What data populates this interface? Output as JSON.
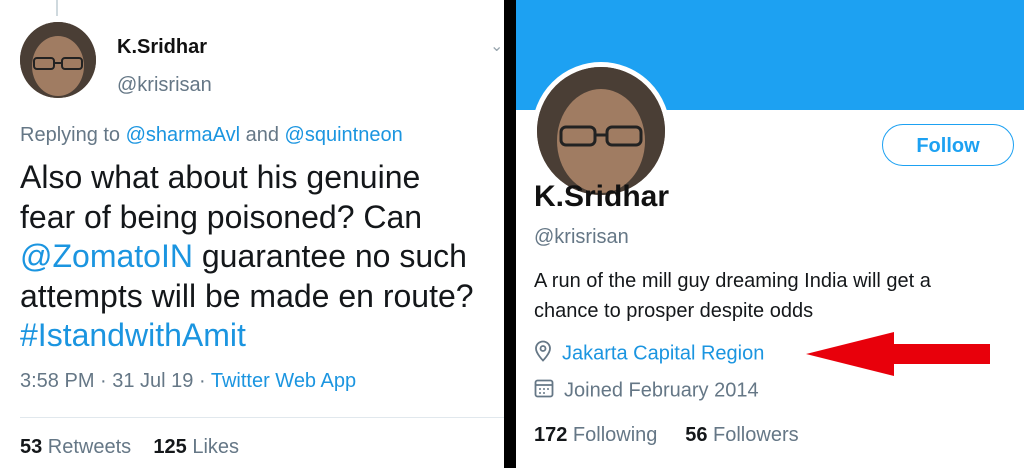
{
  "tweet": {
    "name": "K.Sridhar",
    "handle": "@krisrisan",
    "replying_prefix": "Replying to ",
    "reply_user1": "@sharmaAvl",
    "reply_and": " and ",
    "reply_user2": "@squintneon",
    "line1": "Also what about his genuine",
    "line2": "fear of being poisoned? Can",
    "mention": "@ZomatoIN",
    "line3_rest": " guarantee no such",
    "line4": "attempts will be made en route?",
    "hashtag": "#IstandwithAmit",
    "time_date": "3:58 PM · 31 Jul 19 · ",
    "source": "Twitter Web App",
    "retweets_count": "53",
    "retweets_label": " Retweets",
    "likes_count": "125",
    "likes_label": " Likes"
  },
  "profile": {
    "follow_label": "Follow",
    "name": "K.Sridhar",
    "handle": "@krisrisan",
    "bio_line1": "A run of the mill guy dreaming India will get a",
    "bio_line2": "chance to prosper despite odds",
    "location": "Jakarta Capital Region",
    "joined": "Joined February 2014",
    "following_count": "172",
    "following_label": " Following",
    "followers_count": "56",
    "followers_label": " Followers"
  },
  "colors": {
    "link": "#1b95e0",
    "banner": "#1da1f2",
    "arrow": "#e8000b"
  },
  "icons": {
    "location": "location-pin-icon",
    "calendar": "calendar-icon",
    "caret": "chevron-down-icon"
  }
}
